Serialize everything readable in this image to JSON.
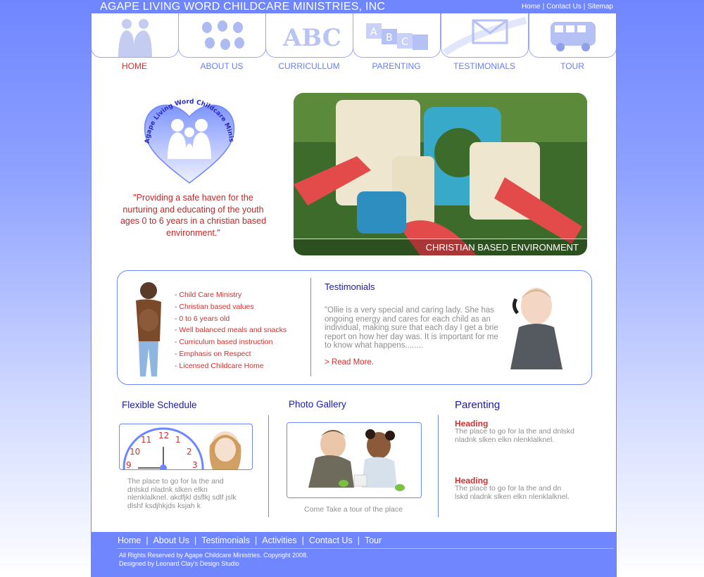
{
  "header": {
    "title": "AGAPE LIVING WORD CHILDCARE MINISTRIES, INC",
    "links": [
      "Home",
      "Contact Us",
      "Sitemap"
    ]
  },
  "nav": [
    {
      "label": "HOME",
      "icon": "family-silhouette-icon",
      "active": true
    },
    {
      "label": "ABOUT US",
      "icon": "handprints-icon",
      "active": false
    },
    {
      "label": "CURRICULLUM",
      "icon": "abc-letters-icon",
      "active": false
    },
    {
      "label": "PARENTING",
      "icon": "alphabet-blocks-icon",
      "active": false
    },
    {
      "label": "TESTIMONIALS",
      "icon": "envelope-icon",
      "active": false
    },
    {
      "label": "TOUR",
      "icon": "bus-icon",
      "active": false
    }
  ],
  "logo": {
    "text": "Agape Living Word Childcare Ministries, Inc."
  },
  "quote": "\"Providing a safe haven for the nurturing and educating of the youth ages 0 to 6 years in a christian based environment.\"",
  "hero": {
    "caption": "CHRISTIAN BASED ENVIRONMENT"
  },
  "features": [
    "- Child Care Ministry",
    "- Christian based values",
    "- 0 to 6 years old",
    "- Well balanced meals and snacks",
    "- Curriculum based instruction",
    "- Emphasis on Respect",
    "- Licensed Childcare Home"
  ],
  "testimonials": {
    "title": "Testimonials",
    "text": "\"Ollie is a very special and caring lady. She has ongoing energy and cares for each child as an individual, making sure that each day I get a brief report on how her day was. It is important for me to know what happens........",
    "read_more": "> Read More."
  },
  "schedule": {
    "title": "Flexible Schedule",
    "clock_numbers": [
      "12",
      "1",
      "2",
      "3",
      "9",
      "10",
      "11"
    ],
    "text": "The place to go for la the and dnlskd nladnk slken elkn nlenklalknel. akdfjkl dsflkj sdlf jslk dlshf ksdjhkjds ksjah k"
  },
  "gallery": {
    "title": "Photo Gallery",
    "caption": "Come Take a tour of the place"
  },
  "parenting": {
    "title": "Parenting",
    "items": [
      {
        "heading": "Heading",
        "text": "The place to go for la the and dnlskd nladnk slken elkn nlenklalknel."
      },
      {
        "heading": "Heading",
        "text": "The place to go for la the and dn lskd nladnk slken elkn nlenklalknel."
      }
    ]
  },
  "footer": {
    "links": [
      "Home",
      "About Us",
      "Testimonials",
      "Activities",
      "Contact Us",
      "Tour"
    ],
    "copyright": "All Rights Reserved by Agape Childcare Ministries. Copyright 2008.",
    "designer": "Designed by Leonard Clay's Design Studio"
  },
  "colors": {
    "accent": "#6f86ff",
    "red": "#d03030",
    "navy": "#1a1ab0"
  }
}
